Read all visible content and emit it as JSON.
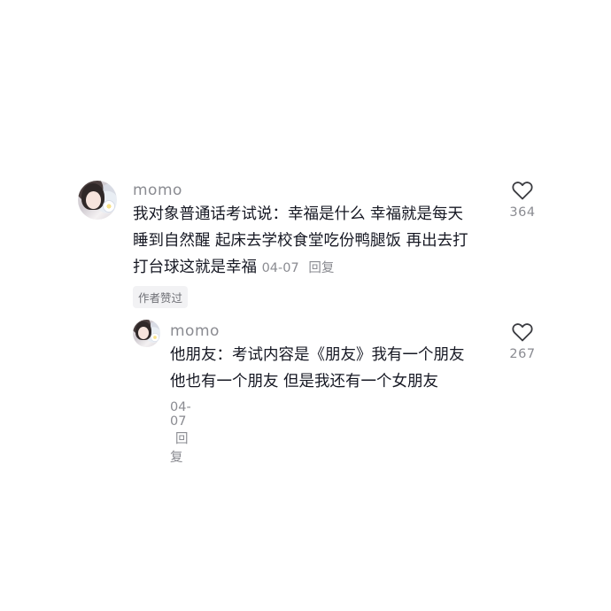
{
  "comments": [
    {
      "username": "momo",
      "lines": [
        "我对象普通话考试说：幸福是什么 幸福就是每天",
        "睡到自然醒 起床去学校食堂吃份鸭腿饭 再出去打",
        "打台球这就是幸福"
      ],
      "date": "04-07",
      "reply_label": "回复",
      "badge": "作者赞过",
      "likes": "364",
      "like_icon": "heart-outline-icon"
    },
    {
      "username": "momo",
      "lines": [
        "他朋友：考试内容是《朋友》我有一个朋友",
        "他也有一个朋友 但是我还有一个女朋友"
      ],
      "date": "04-07",
      "reply_label": "回复",
      "likes": "267",
      "like_icon": "heart-outline-icon"
    }
  ],
  "colors": {
    "text": "#161823",
    "secondary": "#8a8b91",
    "badge_bg": "#f2f2f4"
  }
}
